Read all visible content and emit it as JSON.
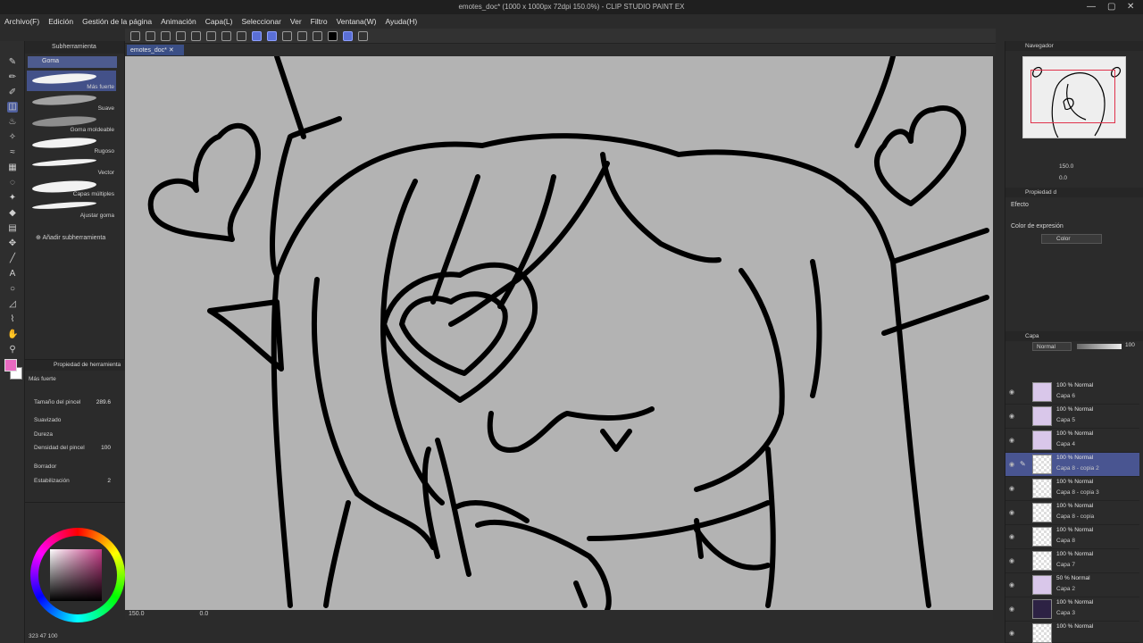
{
  "app": {
    "window_title": "emotes_doc* (1000 x 1000px 72dpi 150.0%) - CLIP STUDIO PAINT EX"
  },
  "menu": [
    "Archivo(F)",
    "Edición",
    "Gestión de la página",
    "Animación",
    "Capa(L)",
    "Seleccionar",
    "Ver",
    "Filtro",
    "Ventana(W)",
    "Ayuda(H)"
  ],
  "document_tab": "emotes_doc*",
  "subtool": {
    "panel_title": "Subherramienta",
    "group": "Goma",
    "items": [
      "Más fuerte",
      "Suave",
      "Goma moldeable",
      "Rugoso",
      "Vector",
      "Capas múltiples",
      "Ajustar goma"
    ],
    "add_label": "Añadir subherramienta"
  },
  "tool_property": {
    "panel_title": "Propiedad de herramienta",
    "preset_name": "Más fuerte",
    "rows": {
      "size_label": "Tamaño del pincel",
      "size_value": "289.6",
      "smoothing_label": "Suavizado",
      "hardness_label": "Dureza",
      "density_label": "Densidad del pincel",
      "density_value": "100",
      "vector_label": "Borrador",
      "stabilization_label": "Estabilización",
      "stabilization_value": "2"
    }
  },
  "color": {
    "readout": "323 47 100",
    "main_color": "#e86ac1",
    "sub_color": "#ffffff"
  },
  "status": {
    "zoom": "150.0",
    "angle": "0.0"
  },
  "navigator": {
    "title": "Navegador",
    "zoom": "150.0",
    "angle": "0.0"
  },
  "layer_property": {
    "title": "Propiedad d",
    "effect_label": "Efecto",
    "expression_label": "Color de expresión",
    "expression_value": "Color"
  },
  "layers_panel": {
    "title": "Capa",
    "blend_mode": "Normal",
    "opacity": "100",
    "layers": [
      {
        "mode": "100 % Normal",
        "name": "Capa 6",
        "thumb": "purple"
      },
      {
        "mode": "100 % Normal",
        "name": "Capa 5",
        "thumb": "purple"
      },
      {
        "mode": "100 % Normal",
        "name": "Capa 4",
        "thumb": "purple"
      },
      {
        "mode": "100 % Normal",
        "name": "Capa 8 - copia 2",
        "thumb": "checker",
        "selected": true
      },
      {
        "mode": "100 % Normal",
        "name": "Capa 8 - copia 3",
        "thumb": "checker"
      },
      {
        "mode": "100 % Normal",
        "name": "Capa 8 - copia",
        "thumb": "checker"
      },
      {
        "mode": "100 % Normal",
        "name": "Capa 8",
        "thumb": "checker"
      },
      {
        "mode": "100 % Normal",
        "name": "Capa 7",
        "thumb": "checker"
      },
      {
        "mode": "50 % Normal",
        "name": "Capa 2",
        "thumb": "purple"
      },
      {
        "mode": "100 % Normal",
        "name": "Capa 3",
        "thumb": "dark"
      },
      {
        "mode": "100 % Normal",
        "name": "",
        "thumb": "checker"
      }
    ]
  },
  "colors": {
    "accent": "#4d5b8f",
    "canvas_bg": "#b3b3b3",
    "ui_bg": "#2b2b2b"
  }
}
